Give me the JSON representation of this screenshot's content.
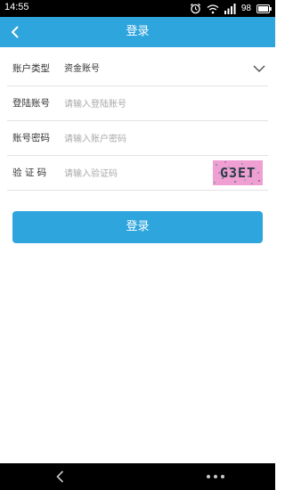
{
  "status_bar": {
    "time": "14:55",
    "battery_level": "98",
    "icons": [
      "alarm-icon",
      "wifi-icon",
      "signal-icon",
      "battery-icon"
    ]
  },
  "header": {
    "title": "登录",
    "back_icon": "chevron-left-icon"
  },
  "form": {
    "account_type": {
      "label": "账户类型",
      "value": "资金账号",
      "icon": "chevron-down-icon"
    },
    "login_account": {
      "label": "登陆账号",
      "placeholder": "请输入登陆账号"
    },
    "password": {
      "label": "账号密码",
      "placeholder": "请输入账户密码"
    },
    "captcha": {
      "label": "验 证 码",
      "placeholder": "请输入验证码",
      "code": "G3ET"
    }
  },
  "login_button": {
    "label": "登录"
  },
  "nav_bar": {
    "icons": [
      "back-icon",
      "more-icon"
    ]
  },
  "colors": {
    "accent": "#2fa5dd",
    "captcha_bg": "#ef9fd2"
  }
}
